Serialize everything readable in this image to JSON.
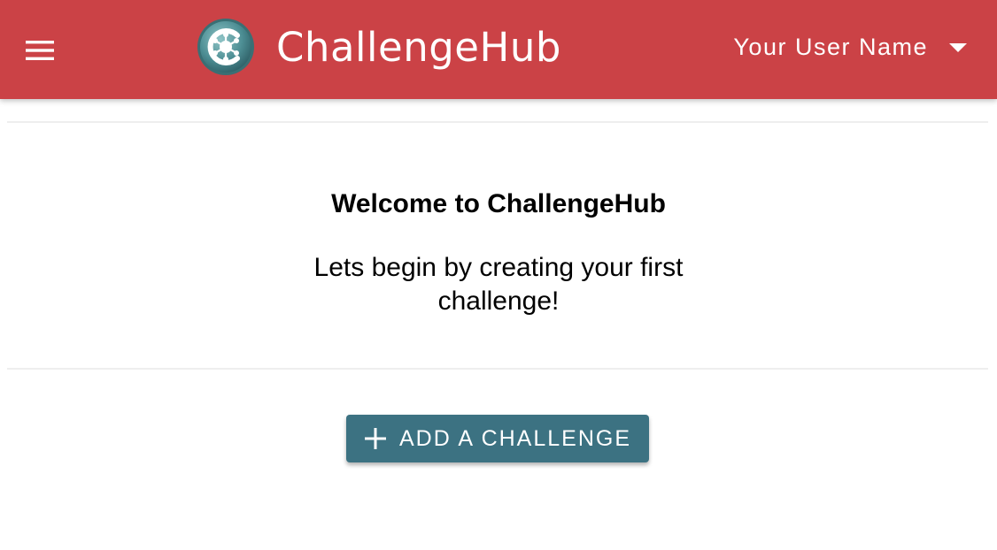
{
  "app": {
    "name": "ChallengeHub",
    "brand_color": "#cb4246",
    "logo_icon": "challengehub-logo-icon"
  },
  "header": {
    "menu_icon": "hamburger-menu-icon",
    "user_name": "Your User Name",
    "user_menu_icon": "caret-down-icon"
  },
  "main": {
    "welcome_title": "Welcome to ChallengeHub",
    "welcome_subtitle": "Lets begin by creating your first challenge!",
    "add_button_label": "ADD A CHALLENGE",
    "add_button_icon": "plus-icon",
    "add_button_color": "#3c7282"
  }
}
